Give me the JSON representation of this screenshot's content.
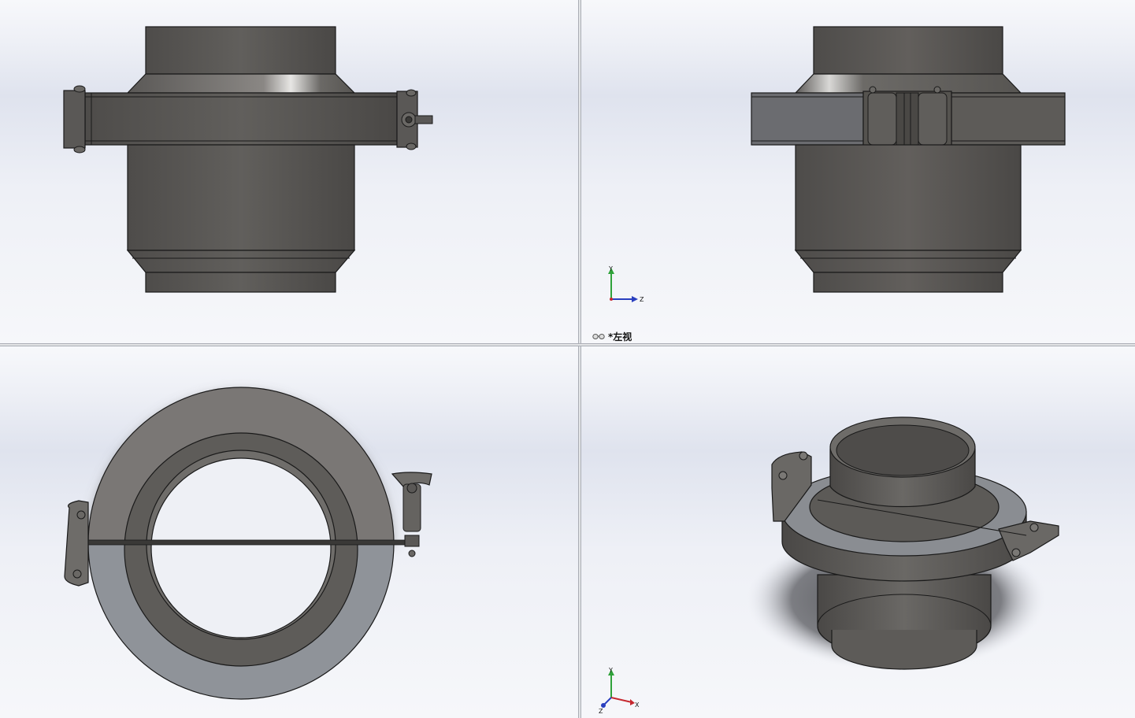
{
  "viewports": {
    "top_left": {
      "view": "front-elevation"
    },
    "top_right": {
      "view": "left-side-elevation",
      "label": "*左视",
      "label_icon": "eyeglasses-icon",
      "triad": {
        "axes": [
          "Y",
          "Z"
        ],
        "axis_colors": {
          "Y": "#2fa23a",
          "Z": "#2a3fbf",
          "X": "#c6282f"
        }
      }
    },
    "bottom_left": {
      "view": "top-plan"
    },
    "bottom_right": {
      "view": "isometric",
      "triad": {
        "axes": [
          "Y",
          "Z",
          "X"
        ],
        "axis_colors": {
          "Y": "#2fa23a",
          "Z": "#2a3fbf",
          "X": "#c6282f"
        }
      }
    }
  },
  "colors": {
    "background": "#e6e9f1",
    "metal_dark": "#5a5855",
    "metal_light": "#8f9399",
    "edge": "#1a1a1a"
  }
}
